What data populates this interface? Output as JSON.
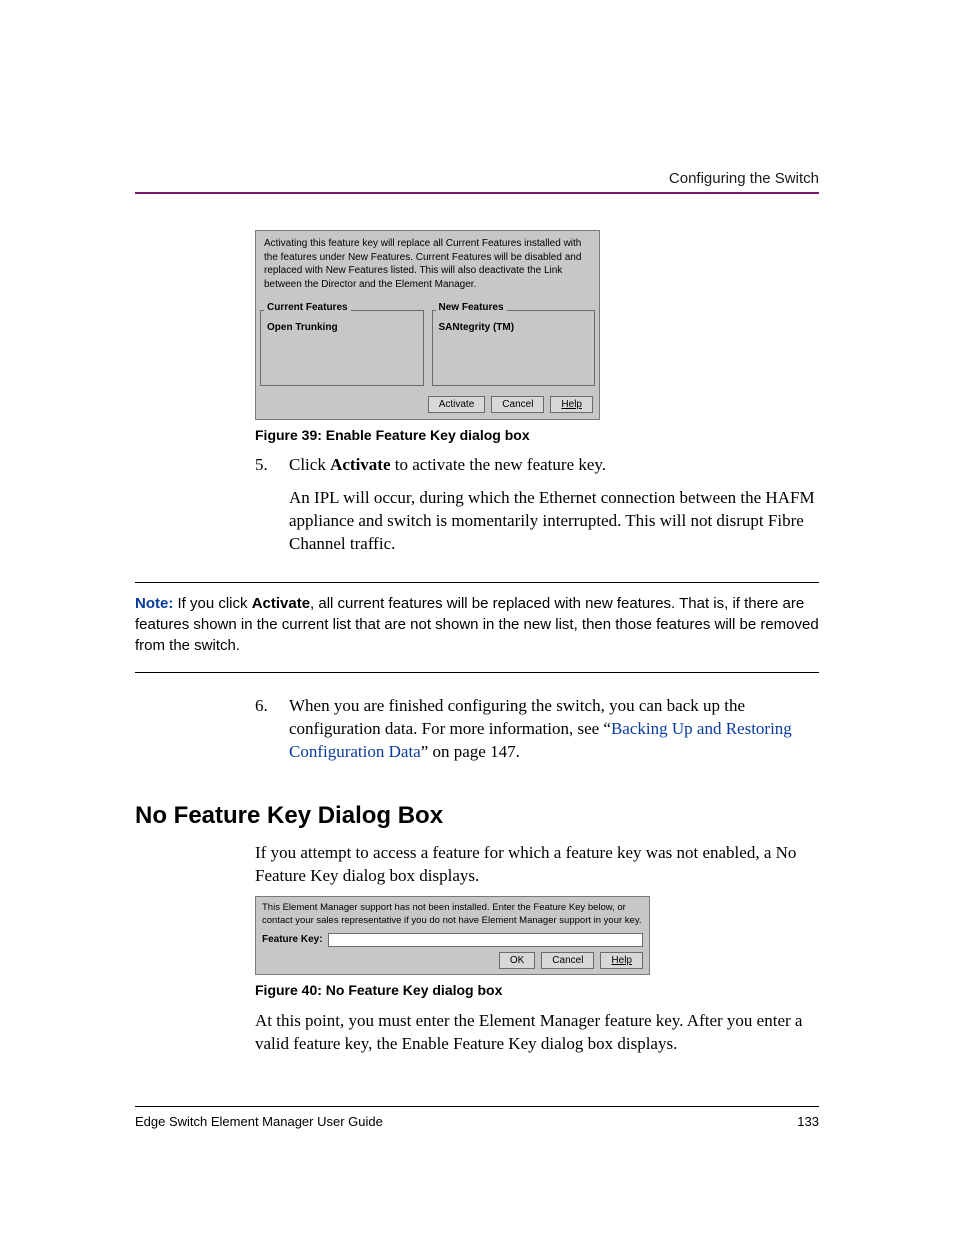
{
  "header": {
    "running": "Configuring the Switch"
  },
  "dialog1": {
    "warning": "Activating this feature key will replace all Current Features installed with the features under New Features. Current Features will be disabled and replaced with New Features listed. This will also deactivate the Link between the Director and the Element Manager.",
    "currentLabel": "Current Features",
    "newLabel": "New Features",
    "currentItem": "Open Trunking",
    "newItem": "SANtegrity (TM)",
    "buttons": {
      "activate": "Activate",
      "cancel": "Cancel",
      "help": "Help"
    }
  },
  "fig39": "Figure 39:  Enable Feature Key dialog box",
  "step5": {
    "num": "5.",
    "line1a": "Click ",
    "line1b": "Activate",
    "line1c": " to activate the new feature key.",
    "p2": "An IPL will occur, during which the Ethernet connection between the HAFM appliance and switch is momentarily interrupted. This will not disrupt Fibre Channel traffic."
  },
  "note": {
    "label": "Note:  ",
    "a": "If you click ",
    "b": "Activate",
    "c": ", all current features will be replaced with new features. That is, if there are features shown in the current list that are not shown in the new list, then those features will be removed from the switch."
  },
  "step6": {
    "num": "6.",
    "a": "When you are finished configuring the switch, you can back up the configuration data. For more information, see “",
    "link": "Backing Up and Restoring Configuration Data",
    "b": "” on page 147."
  },
  "h2": "No Feature Key Dialog Box",
  "intro2": "If you attempt to access a feature for which a feature key was not enabled, a No Feature Key dialog box displays.",
  "dialog2": {
    "msg": "This Element Manager support has not been installed. Enter the Feature Key below, or contact your sales representative if you do not have Element Manager support in your key.",
    "label": "Feature Key:",
    "buttons": {
      "ok": "OK",
      "cancel": "Cancel",
      "help": "Help"
    }
  },
  "fig40": "Figure 40:  No Feature Key dialog box",
  "closing": "At this point, you must enter the Element Manager feature key. After you enter a valid feature key, the Enable Feature Key dialog box displays.",
  "footer": {
    "left": "Edge Switch Element Manager User Guide",
    "right": "133"
  }
}
